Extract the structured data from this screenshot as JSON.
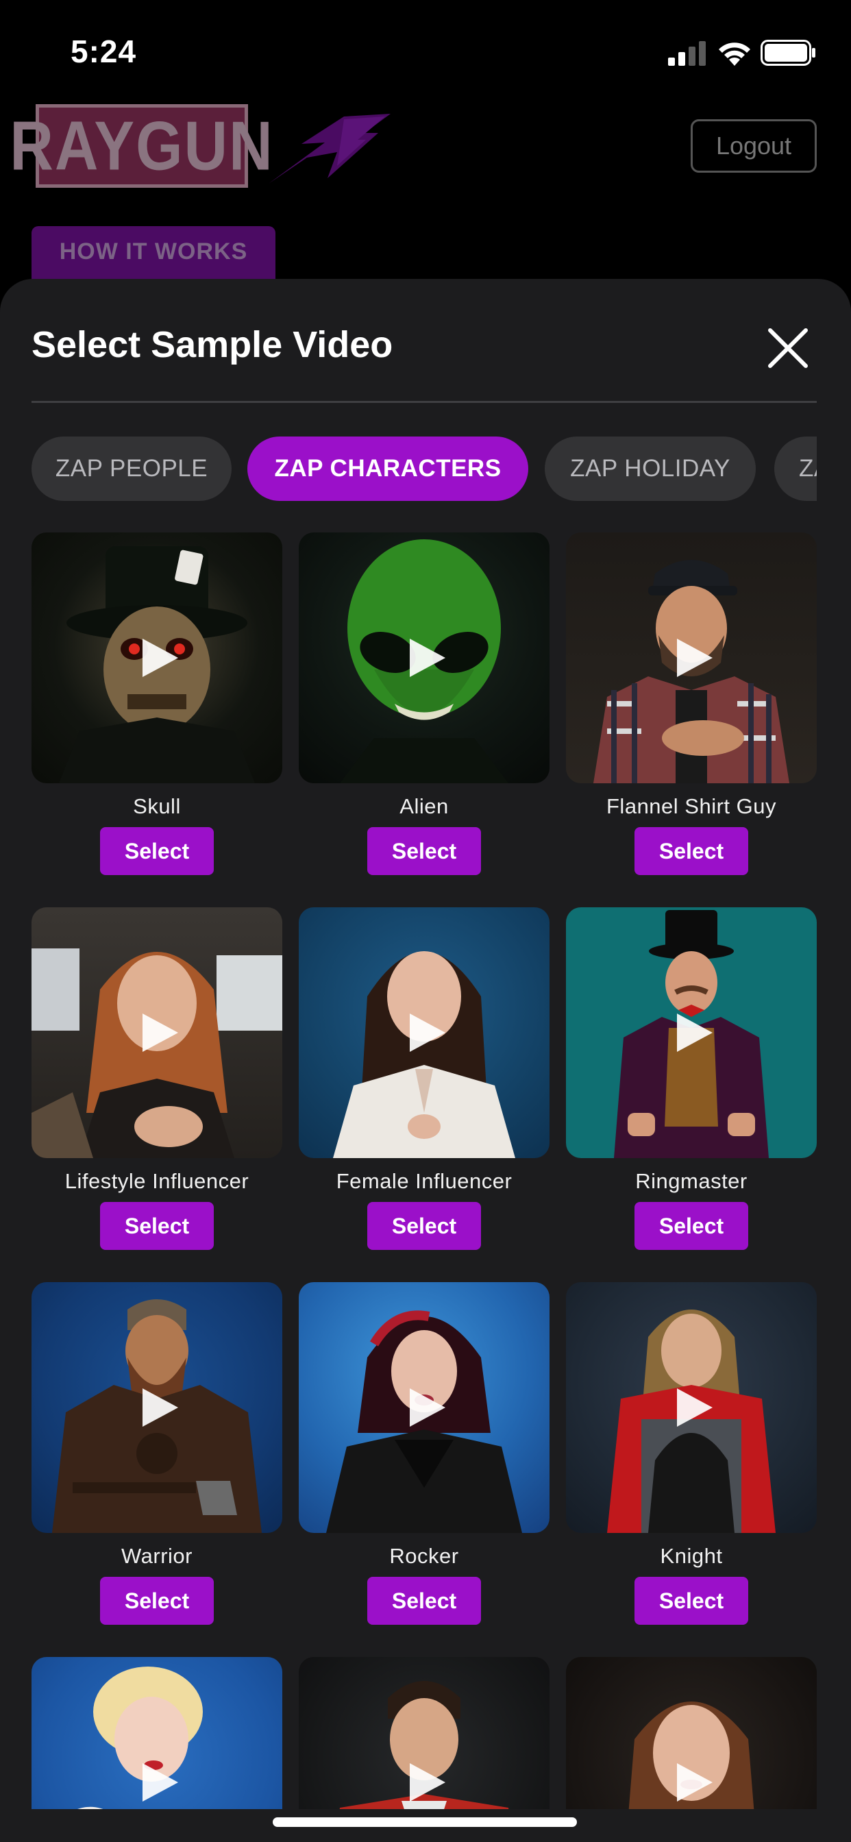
{
  "status_bar": {
    "time": "5:24"
  },
  "header": {
    "logo_text": "RAYGUN",
    "logout_label": "Logout",
    "how_it_works_label": "HOW IT WORKS"
  },
  "sheet": {
    "title": "Select Sample Video",
    "tabs": [
      {
        "label": "ZAP PEOPLE",
        "active": false
      },
      {
        "label": "ZAP CHARACTERS",
        "active": true
      },
      {
        "label": "ZAP HOLIDAY",
        "active": false
      },
      {
        "label": "ZA",
        "active": false
      }
    ],
    "select_label": "Select",
    "videos": [
      {
        "name": "Skull"
      },
      {
        "name": "Alien"
      },
      {
        "name": "Flannel Shirt Guy"
      },
      {
        "name": "Lifestyle Influencer"
      },
      {
        "name": "Female Influencer"
      },
      {
        "name": "Ringmaster"
      },
      {
        "name": "Warrior"
      },
      {
        "name": "Rocker"
      },
      {
        "name": "Knight"
      },
      {
        "name": ""
      },
      {
        "name": ""
      },
      {
        "name": ""
      }
    ]
  },
  "colors": {
    "accent": "#9b10c9",
    "sheet_background": "#1c1c1e",
    "inactive_tab": "#333335"
  }
}
